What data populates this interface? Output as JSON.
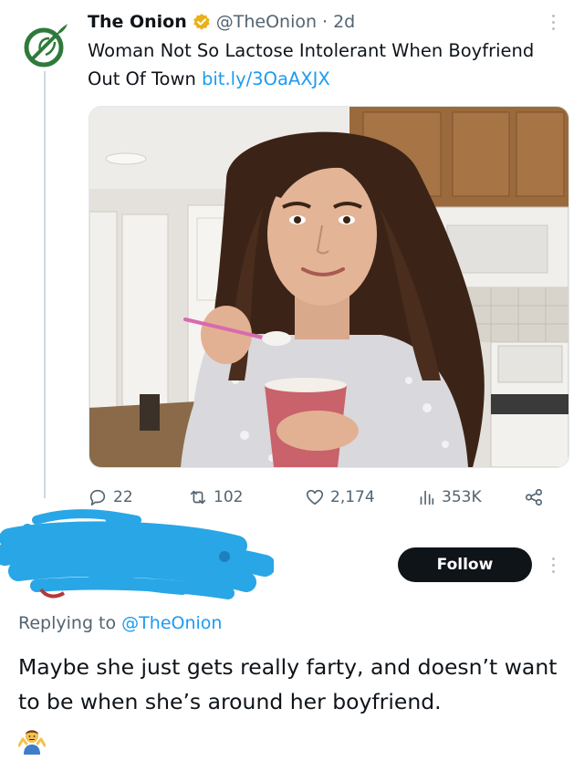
{
  "tweet": {
    "author_name": "The Onion",
    "handle": "@TheOnion",
    "separator": "·",
    "age": "2d",
    "text": "Woman Not So Lactose Intolerant When Boyfriend Out Of Town",
    "link": "bit.ly/3OaAXJX",
    "media": "photo-woman-eating-ice-cream",
    "metrics": {
      "replies": "22",
      "retweets": "102",
      "likes": "2,174",
      "views": "353K"
    }
  },
  "reply": {
    "follow_label": "Follow",
    "replying_prefix": "Replying to",
    "replying_handle": "@TheOnion",
    "text": "Maybe she just gets really farty, and doesn’t want to be when she’s around her boyfriend.",
    "emoji": "man-shrugging-emoji",
    "redaction_color": "#29a6e6"
  },
  "colors": {
    "brand_green": "#2f7a3b",
    "link_blue": "#1d9bf0",
    "secondary_text": "#536471",
    "follow_button": "#0f1419"
  }
}
